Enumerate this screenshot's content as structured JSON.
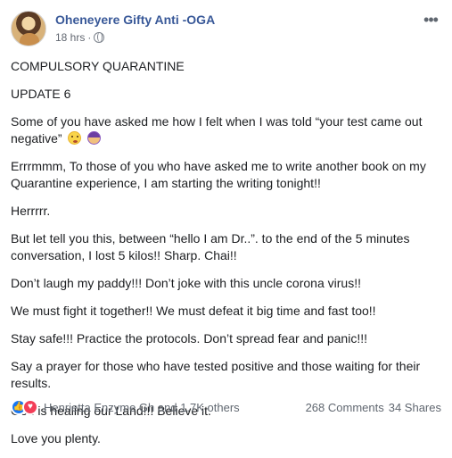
{
  "post": {
    "author": "Oheneyere Gifty Anti -OGA",
    "time": "18 hrs",
    "privacy_icon": "globe-icon",
    "paragraphs": [
      "COMPULSORY QUARANTINE",
      "UPDATE 6",
      "Some of you have asked me how I felt when I was told “your test came out negative”",
      "Errrmmm, To those of you who have asked me to write another book on my Quarantine experience, I am starting the writing tonight!!",
      "Herrrrr.",
      "But let tell you this, between “hello I am Dr..”. to the end of the 5 minutes conversation, I lost 5 kilos!! Sharp. Chai!!",
      "Don’t laugh my paddy!!! Don’t joke with this uncle corona virus!!",
      "We must fight it together!! We must defeat it big time and fast too!!",
      "Stay safe!!! Practice the protocols. Don’t spread fear and panic!!!",
      "Say a prayer for those who have tested positive and those waiting for their results.",
      "God is healing our Land!!! Believe it.",
      "Love you plenty."
    ],
    "emoji_after_negative": [
      "flushed-face-emoji",
      "woman-gesturing-emoji"
    ]
  },
  "footer": {
    "reaction_icons": [
      "like-icon",
      "love-icon"
    ],
    "reactors": "Henrietta Enzyme Gh and 1.7K others",
    "comments": "268 Comments",
    "shares": "34 Shares"
  },
  "colors": {
    "author_blue": "#385898",
    "meta_gray": "#616770",
    "like_blue": "#1877f2",
    "love_red": "#f33e58"
  }
}
